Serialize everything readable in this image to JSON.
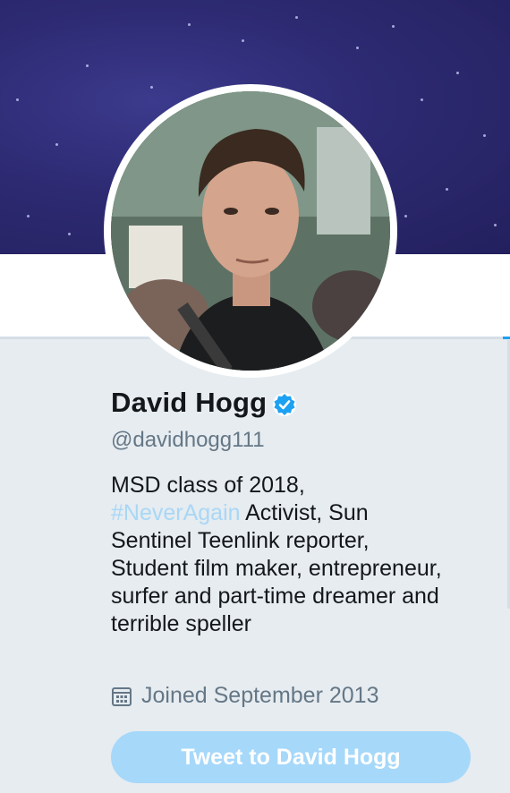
{
  "profile": {
    "name": "David Hogg",
    "handle": "@davidhogg111",
    "verified": true,
    "bio": {
      "line1": "MSD class of 2018,",
      "hashtag": "#NeverAgain",
      "rest": " Activist, Sun Sentinel Teenlink reporter, Student film maker, entrepreneur, surfer and part-time dreamer and terrible speller"
    },
    "joined": "Joined September 2013"
  },
  "actions": {
    "tweet_to_label": "Tweet to David Hogg"
  },
  "icons": {
    "verified": "verified-badge-icon",
    "calendar": "calendar-icon"
  },
  "colors": {
    "background": "#e6ecf0",
    "accent": "#1da1f2",
    "hashtag": "#a9d7f6",
    "button": "#a6d8fa",
    "secondary_text": "#657786"
  }
}
